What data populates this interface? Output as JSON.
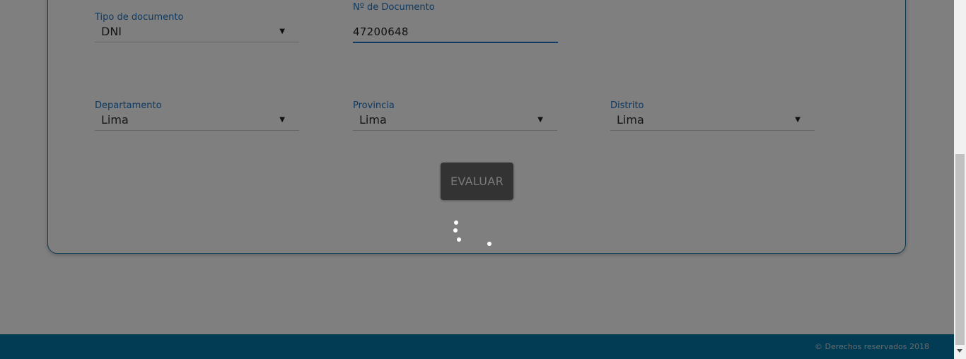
{
  "form": {
    "tipo_documento": {
      "label": "Tipo de documento",
      "value": "DNI"
    },
    "numero_documento": {
      "label": "Nº de Documento",
      "value": "47200648"
    },
    "departamento": {
      "label": "Departamento",
      "value": "Lima"
    },
    "provincia": {
      "label": "Provincia",
      "value": "Lima"
    },
    "distrito": {
      "label": "Distrito",
      "value": "Lima"
    },
    "caret": "▼",
    "submit_label": "EVALUAR"
  },
  "footer": {
    "copyright": "© Derechos reservados 2018"
  },
  "colors": {
    "accent": "#1a73c4",
    "footer_bg": "#0279a8",
    "button_bg": "#676767",
    "overlay": "rgba(0,0,0,0.5)"
  }
}
